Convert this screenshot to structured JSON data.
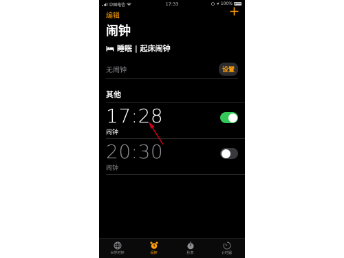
{
  "status_bar": {
    "carrier": "中国电信",
    "time": "17:33",
    "battery": "100%"
  },
  "nav": {
    "edit_label": "编辑",
    "add_icon": "plus-icon"
  },
  "title": "闹钟",
  "sleep": {
    "icon": "bed-icon",
    "header": "睡眠 | 起床闹钟",
    "no_alarm_label": "无闹钟",
    "setup_button": "设置"
  },
  "others": {
    "section_title": "其他",
    "alarms": [
      {
        "time": "17:28",
        "label": "闹钟",
        "enabled": true
      },
      {
        "time": "20:30",
        "label": "闹钟",
        "enabled": false
      }
    ]
  },
  "tab_bar": {
    "tabs": [
      {
        "label": "世界时钟",
        "icon": "globe-icon",
        "active": false
      },
      {
        "label": "闹钟",
        "icon": "alarm-clock-icon",
        "active": true
      },
      {
        "label": "秒表",
        "icon": "stopwatch-icon",
        "active": false
      },
      {
        "label": "计时器",
        "icon": "timer-icon",
        "active": false
      }
    ]
  },
  "colors": {
    "accent": "#ff9f0a",
    "toggle_on": "#34c759",
    "background": "#000000",
    "annotation_arrow": "#d0021b"
  }
}
